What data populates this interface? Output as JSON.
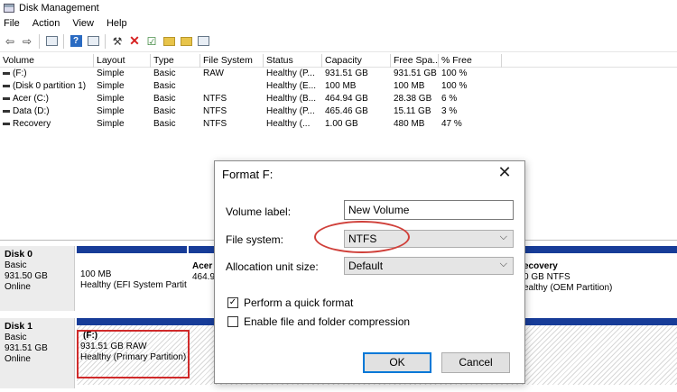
{
  "window": {
    "title": "Disk Management"
  },
  "menu": [
    "File",
    "Action",
    "View",
    "Help"
  ],
  "volumes": {
    "headers": [
      "Volume",
      "Layout",
      "Type",
      "File System",
      "Status",
      "Capacity",
      "Free Spa...",
      "% Free"
    ],
    "rows": [
      [
        "(F:)",
        "Simple",
        "Basic",
        "RAW",
        "Healthy (P...",
        "931.51 GB",
        "931.51 GB",
        "100 %"
      ],
      [
        "(Disk 0 partition 1)",
        "Simple",
        "Basic",
        "",
        "Healthy (E...",
        "100 MB",
        "100 MB",
        "100 %"
      ],
      [
        "Acer (C:)",
        "Simple",
        "Basic",
        "NTFS",
        "Healthy (B...",
        "464.94 GB",
        "28.38 GB",
        "6 %"
      ],
      [
        "Data (D:)",
        "Simple",
        "Basic",
        "NTFS",
        "Healthy (P...",
        "465.46 GB",
        "15.11 GB",
        "3 %"
      ],
      [
        "Recovery",
        "Simple",
        "Basic",
        "NTFS",
        "Healthy (...",
        "1.00 GB",
        "480 MB",
        "47 %"
      ]
    ]
  },
  "disks": {
    "disk0": {
      "name": "Disk 0",
      "type": "Basic",
      "size": "931.50 GB",
      "state": "Online",
      "p1_size": "100 MB",
      "p1_status": "Healthy (EFI System Partiti",
      "p2_name": "Acer",
      "p2_size": "464.9",
      "p3_name": "ecovery",
      "p3_size": "0 GB NTFS",
      "p3_status": "ealthy (OEM Partition)"
    },
    "disk1": {
      "name": "Disk 1",
      "type": "Basic",
      "size": "931.51 GB",
      "state": "Online",
      "p1_name": "(F:)",
      "p1_size": "931.51 GB RAW",
      "p1_status": "Healthy (Primary Partition)"
    }
  },
  "dialog": {
    "title": "Format F:",
    "close": "✕",
    "volume_label_label": "Volume label:",
    "volume_label_value": "New Volume",
    "file_system_label": "File system:",
    "file_system_value": "NTFS",
    "alloc_label": "Allocation unit size:",
    "alloc_value": "Default",
    "quick_format_label": "Perform a quick format",
    "quick_format_checked": true,
    "compression_label": "Enable file and folder compression",
    "compression_checked": false,
    "ok": "OK",
    "cancel": "Cancel"
  },
  "colors": {
    "disk_bar": "#173c98",
    "highlight": "#d02a2a",
    "dialog_focus": "#0078d7"
  },
  "icons": [
    "back-arrow-icon",
    "forward-arrow-icon",
    "properties-icon",
    "help-icon",
    "connect-icon",
    "delete-icon",
    "check-icon",
    "folder-icon",
    "search-folder-icon",
    "view-icon"
  ]
}
